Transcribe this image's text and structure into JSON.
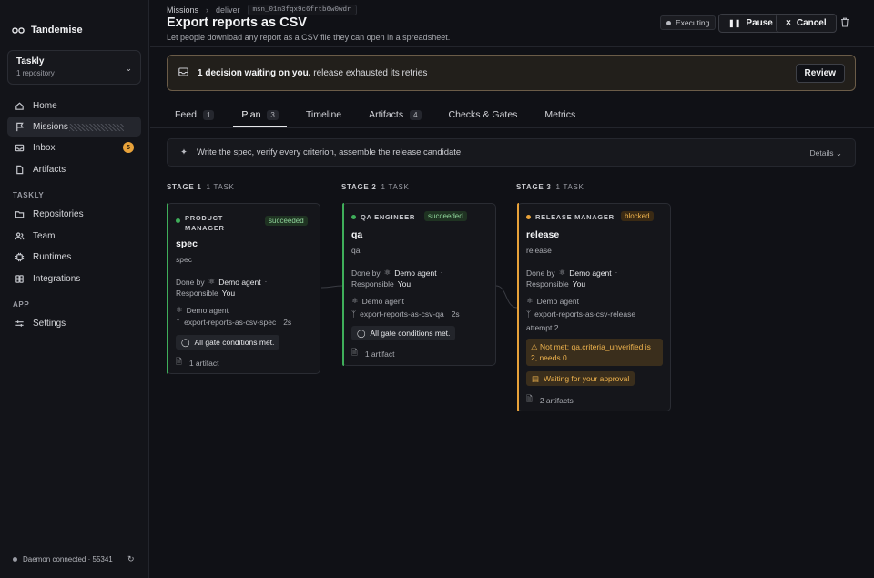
{
  "sidebar": {
    "brand": "Tandemise",
    "workspace": {
      "name": "Taskly",
      "sub": "1 repository"
    },
    "nav": [
      {
        "label": "Home",
        "icon": "home-icon"
      },
      {
        "label": "Missions",
        "icon": "flag-icon",
        "active": true
      },
      {
        "label": "Inbox",
        "icon": "inbox-icon",
        "badge": "5"
      },
      {
        "label": "Artifacts",
        "icon": "file-icon"
      }
    ],
    "section_taskly": "TASKLY",
    "taskly_nav": [
      {
        "label": "Repositories",
        "icon": "folder-icon"
      },
      {
        "label": "Team",
        "icon": "users-icon"
      },
      {
        "label": "Runtimes",
        "icon": "cpu-icon"
      },
      {
        "label": "Integrations",
        "icon": "plug-icon"
      }
    ],
    "section_app": "APP",
    "app_nav": [
      {
        "label": "Settings",
        "icon": "sliders-icon"
      }
    ],
    "daemon_status": "Daemon connected · 55341"
  },
  "header": {
    "breadcrumb": [
      "Missions",
      "deliver"
    ],
    "mission_id": "msn_01m3fqx9c6frtb6w0wdr",
    "title": "Export reports as CSV",
    "subtitle": "Let people download any report as a CSV file they can open in a spreadsheet.",
    "status": "Executing",
    "pause_label": "Pause",
    "cancel_label": "Cancel"
  },
  "decision": {
    "bold": "1 decision waiting on you.",
    "text": "release exhausted its retries",
    "button": "Review"
  },
  "tabs": [
    {
      "label": "Feed",
      "count": "1"
    },
    {
      "label": "Plan",
      "count": "3",
      "active": true
    },
    {
      "label": "Timeline"
    },
    {
      "label": "Artifacts",
      "count": "4"
    },
    {
      "label": "Checks & Gates"
    },
    {
      "label": "Metrics"
    }
  ],
  "plan": {
    "summary": "Write the spec, verify every criterion, assemble the release candidate.",
    "details": "Details"
  },
  "stages": [
    {
      "label": "STAGE 1",
      "tasks": "1 TASK",
      "role": "PRODUCT MANAGER",
      "status": "succeeded",
      "status_color": "#3fae5a",
      "title": "spec",
      "sub": "spec",
      "done_by_label": "Done by",
      "done_by": "Demo agent",
      "responsible_label": "Responsible",
      "responsible": "You",
      "agent": "Demo agent",
      "branch": "export-reports-as-csv-spec",
      "duration": "2s",
      "gate": "All gate conditions met.",
      "artifacts": "1 artifact"
    },
    {
      "label": "STAGE 2",
      "tasks": "1 TASK",
      "role": "QA ENGINEER",
      "status": "succeeded",
      "status_color": "#3fae5a",
      "title": "qa",
      "sub": "qa",
      "done_by_label": "Done by",
      "done_by": "Demo agent",
      "responsible_label": "Responsible",
      "responsible": "You",
      "agent": "Demo agent",
      "branch": "export-reports-as-csv-qa",
      "duration": "2s",
      "gate": "All gate conditions met.",
      "artifacts": "1 artifact"
    },
    {
      "label": "STAGE 3",
      "tasks": "1 TASK",
      "role": "RELEASE MANAGER",
      "status": "blocked",
      "status_color": "#e8a23a",
      "title": "release",
      "sub": "release",
      "done_by_label": "Done by",
      "done_by": "Demo agent",
      "responsible_label": "Responsible",
      "responsible": "You",
      "agent": "Demo agent",
      "branch": "export-reports-as-csv-release",
      "attempt": "attempt 2",
      "warning": "Not met: qa.criteria_unverified is 2, needs 0",
      "waiting": "Waiting for your approval",
      "artifacts": "2 artifacts"
    }
  ]
}
